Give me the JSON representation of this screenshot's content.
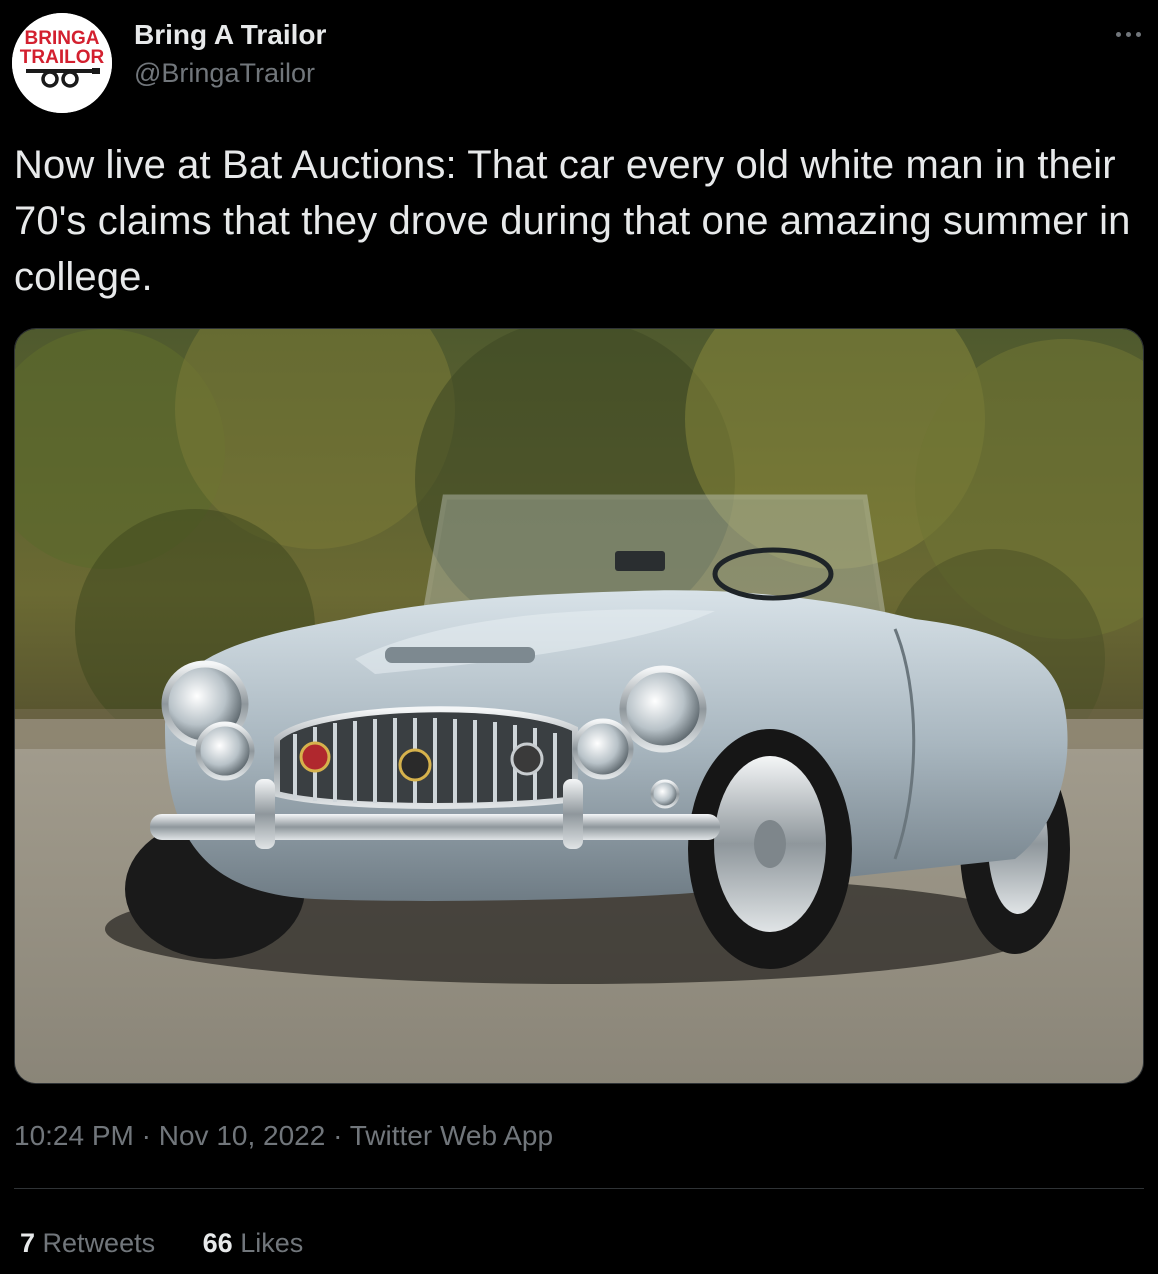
{
  "author": {
    "display_name": "Bring A Trailor",
    "handle": "@BringaTrailor",
    "avatar_logo": {
      "line1": "BRINGA",
      "line2": "TRAILOR",
      "color": "#d3202f"
    }
  },
  "tweet": {
    "text": "Now live at Bat Auctions: That car every old white man in their 70's claims that they drove during that one amazing summer in college.",
    "media": {
      "type": "photo",
      "subject": "silver convertible roadster"
    }
  },
  "meta": {
    "time": "10:24 PM",
    "separator": "·",
    "date": "Nov 10, 2022",
    "source": "Twitter Web App"
  },
  "stats": {
    "retweets_count": "7",
    "retweets_label": "Retweets",
    "likes_count": "66",
    "likes_label": "Likes"
  },
  "icons": {
    "more": "more-horizontal-icon"
  },
  "colors": {
    "background": "#000000",
    "text_primary": "#e7e9ea",
    "text_secondary": "#71767b",
    "border": "#2f3336"
  }
}
